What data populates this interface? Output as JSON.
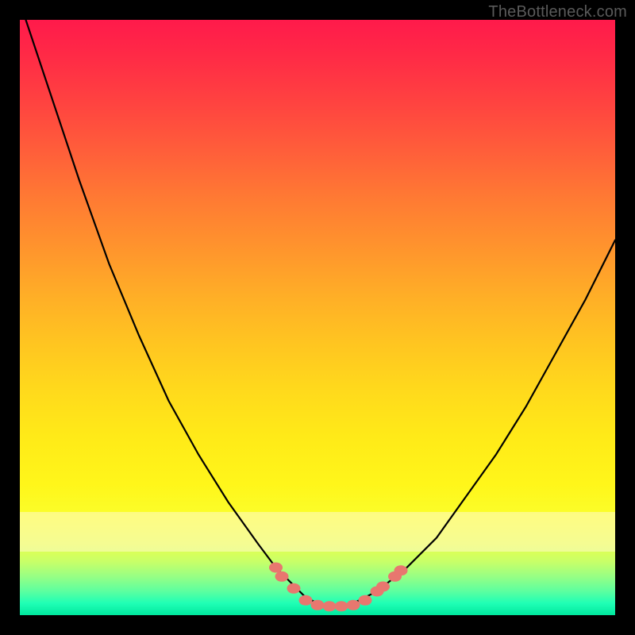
{
  "watermark": {
    "text": "TheBottleneck.com"
  },
  "colors": {
    "curve_stroke": "#000000",
    "marker_fill": "#e8776f",
    "marker_stroke": "#e8776f",
    "band_fill": "rgba(255,250,205,0.55)"
  },
  "chart_data": {
    "type": "line",
    "title": "",
    "xlabel": "",
    "ylabel": "",
    "xlim": [
      0,
      100
    ],
    "ylim": [
      0,
      100
    ],
    "grid": false,
    "legend": false,
    "annotations": [
      {
        "type": "horizontal_band",
        "y0": 82,
        "y1": 89,
        "color": "lemonchiffon",
        "alpha": 0.55
      }
    ],
    "series": [
      {
        "name": "bottleneck-curve",
        "stroke": "#000000",
        "x": [
          1,
          5,
          10,
          15,
          20,
          25,
          30,
          35,
          40,
          43,
          46,
          48,
          50,
          52,
          54,
          56,
          60,
          65,
          70,
          75,
          80,
          85,
          90,
          95,
          100
        ],
        "y": [
          0,
          12,
          27,
          41,
          53,
          64,
          73,
          81,
          88,
          92,
          95,
          97,
          98,
          98.5,
          98.5,
          98,
          96,
          92,
          87,
          80,
          73,
          65,
          56,
          47,
          37
        ]
      }
    ],
    "markers": [
      {
        "name": "highlight-points",
        "shape": "ellipse",
        "fill": "#e8776f",
        "stroke": "#e8776f",
        "points": [
          {
            "x": 43,
            "y": 92
          },
          {
            "x": 44,
            "y": 93.5
          },
          {
            "x": 46,
            "y": 95.5
          },
          {
            "x": 48,
            "y": 97.5
          },
          {
            "x": 50,
            "y": 98.3
          },
          {
            "x": 52,
            "y": 98.5
          },
          {
            "x": 54,
            "y": 98.5
          },
          {
            "x": 56,
            "y": 98.3
          },
          {
            "x": 58,
            "y": 97.5
          },
          {
            "x": 60,
            "y": 96
          },
          {
            "x": 61,
            "y": 95.2
          },
          {
            "x": 63,
            "y": 93.5
          },
          {
            "x": 64,
            "y": 92.5
          }
        ]
      }
    ],
    "background_gradient": {
      "direction": "top-to-bottom",
      "stops": [
        {
          "offset": 0.0,
          "color": "#ff1a4b"
        },
        {
          "offset": 0.25,
          "color": "#ff7a33"
        },
        {
          "offset": 0.5,
          "color": "#ffc421"
        },
        {
          "offset": 0.75,
          "color": "#fff61a"
        },
        {
          "offset": 1.0,
          "color": "#00e89e"
        }
      ]
    }
  }
}
